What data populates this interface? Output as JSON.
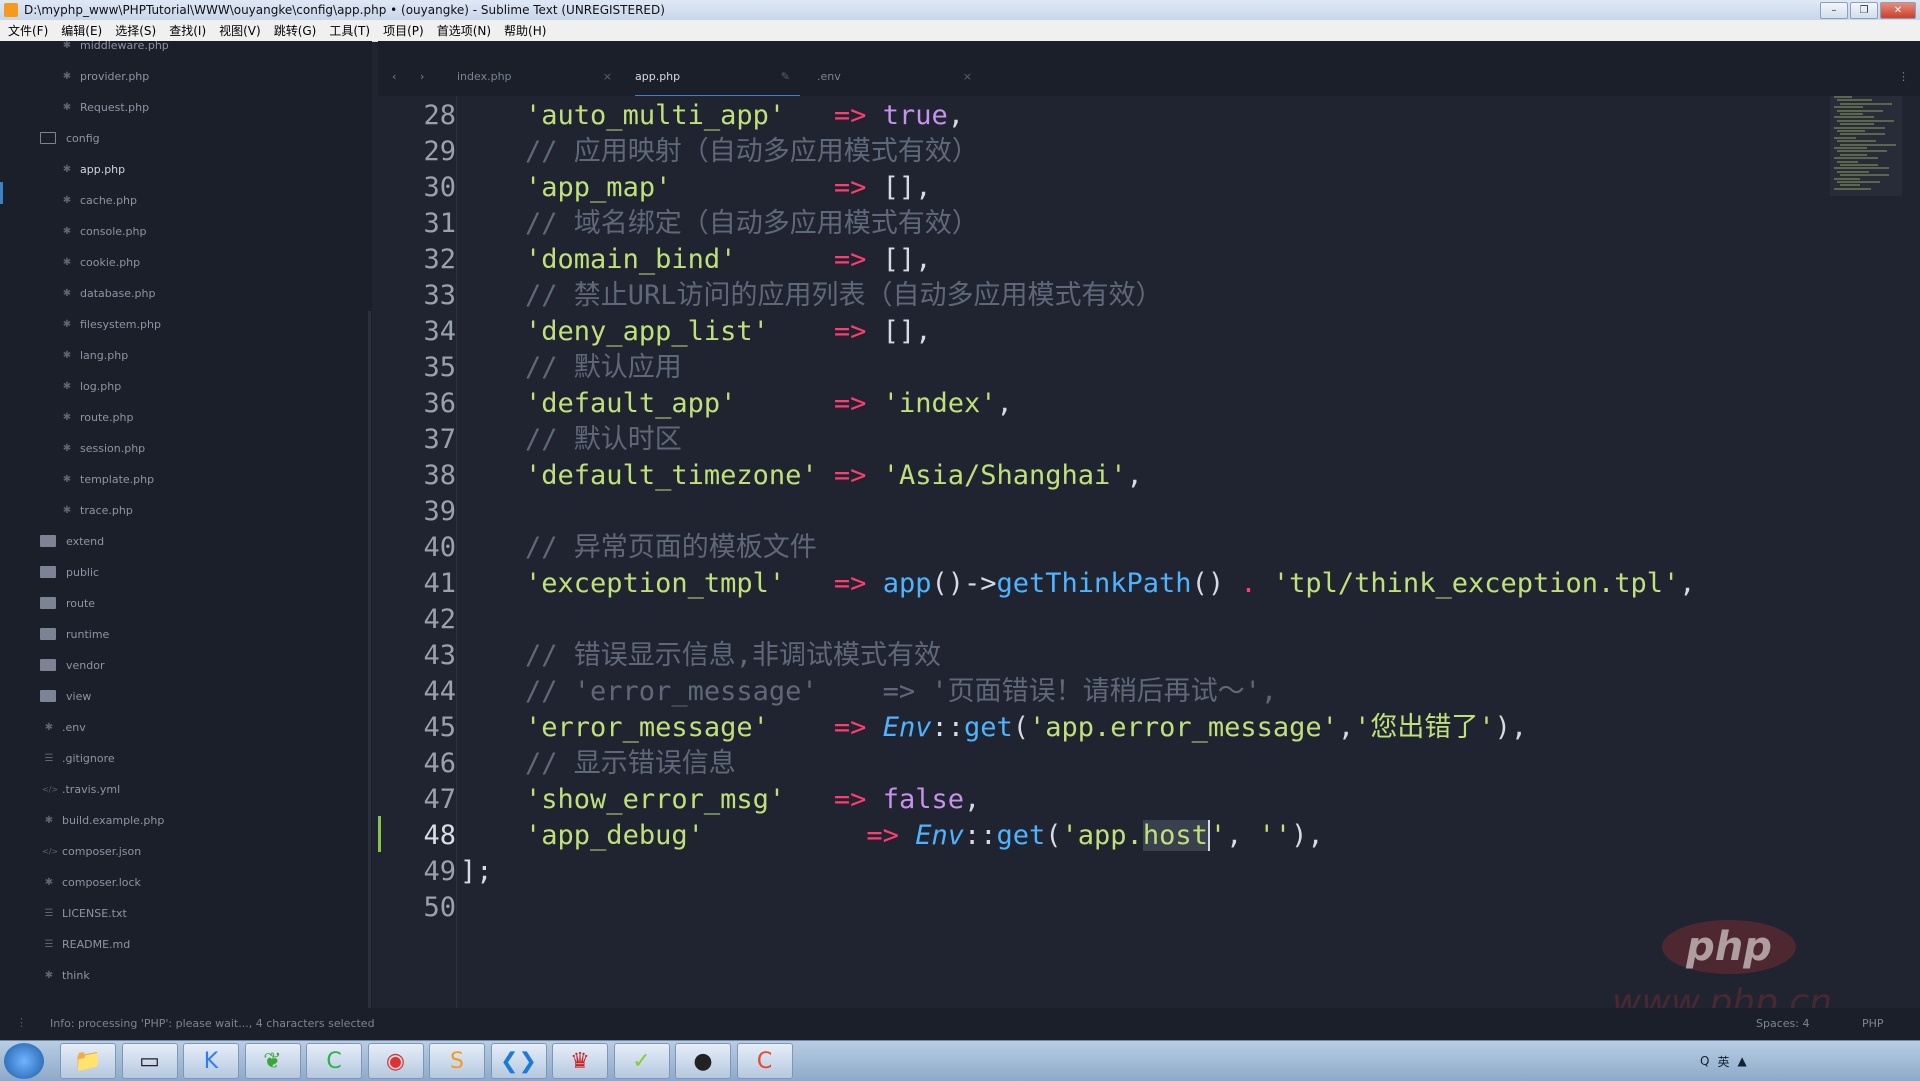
{
  "window": {
    "title": "D:\\myphp_www\\PHPTutorial\\WWW\\ouyangke\\config\\app.php • (ouyangke) - Sublime Text (UNREGISTERED)",
    "controls": [
      "–",
      "❐",
      "✕"
    ]
  },
  "menu": [
    "文件(F)",
    "编辑(E)",
    "选择(S)",
    "查找(I)",
    "视图(V)",
    "跳转(G)",
    "工具(T)",
    "项目(P)",
    "首选项(N)",
    "帮助(H)"
  ],
  "sidebar": {
    "items": [
      {
        "label": "middleware.php",
        "type": "file",
        "icon": "asterisk-icon"
      },
      {
        "label": "provider.php",
        "type": "file",
        "icon": "asterisk-icon"
      },
      {
        "label": "Request.php",
        "type": "file",
        "icon": "asterisk-icon"
      },
      {
        "label": "config",
        "type": "folder-open",
        "icon": "folder-open-icon"
      },
      {
        "label": "app.php",
        "type": "file",
        "icon": "asterisk-icon",
        "active": true
      },
      {
        "label": "cache.php",
        "type": "file",
        "icon": "asterisk-icon"
      },
      {
        "label": "console.php",
        "type": "file",
        "icon": "asterisk-icon"
      },
      {
        "label": "cookie.php",
        "type": "file",
        "icon": "asterisk-icon"
      },
      {
        "label": "database.php",
        "type": "file",
        "icon": "asterisk-icon"
      },
      {
        "label": "filesystem.php",
        "type": "file",
        "icon": "asterisk-icon"
      },
      {
        "label": "lang.php",
        "type": "file",
        "icon": "asterisk-icon"
      },
      {
        "label": "log.php",
        "type": "file",
        "icon": "asterisk-icon"
      },
      {
        "label": "route.php",
        "type": "file",
        "icon": "asterisk-icon"
      },
      {
        "label": "session.php",
        "type": "file",
        "icon": "asterisk-icon"
      },
      {
        "label": "template.php",
        "type": "file",
        "icon": "asterisk-icon"
      },
      {
        "label": "trace.php",
        "type": "file",
        "icon": "asterisk-icon"
      },
      {
        "label": "extend",
        "type": "folder",
        "icon": "folder-icon"
      },
      {
        "label": "public",
        "type": "folder",
        "icon": "folder-icon"
      },
      {
        "label": "route",
        "type": "folder",
        "icon": "folder-icon"
      },
      {
        "label": "runtime",
        "type": "folder",
        "icon": "folder-icon"
      },
      {
        "label": "vendor",
        "type": "folder",
        "icon": "folder-icon"
      },
      {
        "label": "view",
        "type": "folder",
        "icon": "folder-icon"
      },
      {
        "label": ".env",
        "type": "rootfile",
        "icon": "asterisk-icon"
      },
      {
        "label": ".gitignore",
        "type": "rootfile",
        "icon": "lines-icon"
      },
      {
        "label": ".travis.yml",
        "type": "rootfile",
        "icon": "code-icon"
      },
      {
        "label": "build.example.php",
        "type": "rootfile",
        "icon": "asterisk-icon"
      },
      {
        "label": "composer.json",
        "type": "rootfile",
        "icon": "code-icon"
      },
      {
        "label": "composer.lock",
        "type": "rootfile",
        "icon": "asterisk-icon"
      },
      {
        "label": "LICENSE.txt",
        "type": "rootfile",
        "icon": "lines-icon"
      },
      {
        "label": "README.md",
        "type": "rootfile",
        "icon": "lines-icon"
      },
      {
        "label": "think",
        "type": "rootfile",
        "icon": "asterisk-icon"
      }
    ]
  },
  "tabs": [
    {
      "label": "index.php",
      "close": "×"
    },
    {
      "label": "app.php",
      "close": "✎",
      "active": true
    },
    {
      "label": ".env",
      "close": "×"
    }
  ],
  "editor": {
    "current_line": 48,
    "lines": [
      {
        "n": 28,
        "tokens": [
          [
            "    ",
            "p"
          ],
          [
            "'auto_multi_app'",
            "s"
          ],
          [
            "   ",
            "p"
          ],
          [
            "=>",
            "o"
          ],
          [
            " ",
            "p"
          ],
          [
            "true",
            "k"
          ],
          [
            ",",
            "p"
          ]
        ]
      },
      {
        "n": 29,
        "tokens": [
          [
            "    // 应用映射（自动多应用模式有效）",
            "c"
          ]
        ]
      },
      {
        "n": 30,
        "tokens": [
          [
            "    ",
            "p"
          ],
          [
            "'app_map'",
            "s"
          ],
          [
            "          ",
            "p"
          ],
          [
            "=>",
            "o"
          ],
          [
            " [],",
            "p"
          ]
        ]
      },
      {
        "n": 31,
        "tokens": [
          [
            "    // 域名绑定（自动多应用模式有效）",
            "c"
          ]
        ]
      },
      {
        "n": 32,
        "tokens": [
          [
            "    ",
            "p"
          ],
          [
            "'domain_bind'",
            "s"
          ],
          [
            "      ",
            "p"
          ],
          [
            "=>",
            "o"
          ],
          [
            " [],",
            "p"
          ]
        ]
      },
      {
        "n": 33,
        "tokens": [
          [
            "    // 禁止URL访问的应用列表（自动多应用模式有效）",
            "c"
          ]
        ]
      },
      {
        "n": 34,
        "tokens": [
          [
            "    ",
            "p"
          ],
          [
            "'deny_app_list'",
            "s"
          ],
          [
            "    ",
            "p"
          ],
          [
            "=>",
            "o"
          ],
          [
            " [],",
            "p"
          ]
        ]
      },
      {
        "n": 35,
        "tokens": [
          [
            "    // 默认应用",
            "c"
          ]
        ]
      },
      {
        "n": 36,
        "tokens": [
          [
            "    ",
            "p"
          ],
          [
            "'default_app'",
            "s"
          ],
          [
            "      ",
            "p"
          ],
          [
            "=>",
            "o"
          ],
          [
            " ",
            "p"
          ],
          [
            "'index'",
            "s"
          ],
          [
            ",",
            "p"
          ]
        ]
      },
      {
        "n": 37,
        "tokens": [
          [
            "    // 默认时区",
            "c"
          ]
        ]
      },
      {
        "n": 38,
        "tokens": [
          [
            "    ",
            "p"
          ],
          [
            "'default_timezone'",
            "s"
          ],
          [
            " ",
            "p"
          ],
          [
            "=>",
            "o"
          ],
          [
            " ",
            "p"
          ],
          [
            "'Asia/Shanghai'",
            "s"
          ],
          [
            ",",
            "p"
          ]
        ]
      },
      {
        "n": 39,
        "tokens": []
      },
      {
        "n": 40,
        "tokens": [
          [
            "    // 异常页面的模板文件",
            "c"
          ]
        ]
      },
      {
        "n": 41,
        "tokens": [
          [
            "    ",
            "p"
          ],
          [
            "'exception_tmpl'",
            "s"
          ],
          [
            "   ",
            "p"
          ],
          [
            "=>",
            "o"
          ],
          [
            " ",
            "p"
          ],
          [
            "app",
            "f"
          ],
          [
            "()->",
            "p"
          ],
          [
            "getThinkPath",
            "f"
          ],
          [
            "() ",
            "p"
          ],
          [
            ".",
            "o"
          ],
          [
            " ",
            "p"
          ],
          [
            "'tpl/think_exception.tpl'",
            "s"
          ],
          [
            ",",
            "p"
          ]
        ]
      },
      {
        "n": 42,
        "tokens": []
      },
      {
        "n": 43,
        "tokens": [
          [
            "    // 错误显示信息,非调试模式有效",
            "c"
          ]
        ]
      },
      {
        "n": 44,
        "tokens": [
          [
            "    // 'error_message'    => '页面错误！请稍后再试～',",
            "c"
          ]
        ]
      },
      {
        "n": 45,
        "tokens": [
          [
            "    ",
            "p"
          ],
          [
            "'error_message'",
            "s"
          ],
          [
            "    ",
            "p"
          ],
          [
            "=>",
            "o"
          ],
          [
            " ",
            "p"
          ],
          [
            "Env",
            "e"
          ],
          [
            "::",
            "p"
          ],
          [
            "get",
            "f"
          ],
          [
            "(",
            "p"
          ],
          [
            "'app.error_message'",
            "s"
          ],
          [
            ",",
            "p"
          ],
          [
            "'您出错了'",
            "s"
          ],
          [
            "),",
            "p"
          ]
        ]
      },
      {
        "n": 46,
        "tokens": [
          [
            "    // 显示错误信息",
            "c"
          ]
        ]
      },
      {
        "n": 47,
        "tokens": [
          [
            "    ",
            "p"
          ],
          [
            "'show_error_msg'",
            "s"
          ],
          [
            "   ",
            "p"
          ],
          [
            "=>",
            "o"
          ],
          [
            " ",
            "p"
          ],
          [
            "false",
            "k"
          ],
          [
            ",",
            "p"
          ]
        ]
      },
      {
        "n": 48,
        "tokens": [
          [
            "    ",
            "p"
          ],
          [
            "'app_debug'",
            "s"
          ],
          [
            "          ",
            "p"
          ],
          [
            "=>",
            "o"
          ],
          [
            " ",
            "p"
          ],
          [
            "Env",
            "e"
          ],
          [
            "::",
            "p"
          ],
          [
            "get",
            "f"
          ],
          [
            "(",
            "p"
          ],
          [
            "'app.",
            "s"
          ],
          [
            "host",
            "s hl"
          ],
          [
            "'",
            "s caret"
          ],
          [
            ", ",
            "p"
          ],
          [
            "''",
            "s"
          ],
          [
            "),",
            "p"
          ]
        ]
      },
      {
        "n": 49,
        "tokens": [
          [
            "];",
            "p"
          ]
        ]
      },
      {
        "n": 50,
        "tokens": []
      }
    ]
  },
  "watermark": {
    "logo": "php",
    "url": "www.php.cn"
  },
  "status": {
    "message": "Info: processing 'PHP': please wait..., 4 characters selected",
    "spaces": "Spaces: 4",
    "syntax": "PHP"
  },
  "taskbar": {
    "apps": [
      "start-orb",
      "file-explorer",
      "terminal",
      "kuaichuan",
      "leaf-app",
      "pycharm-like",
      "chrome",
      "sublime-text",
      "vscode",
      "crown-app",
      "green-app",
      "obs",
      "red-app"
    ],
    "tray": [
      "Q",
      "英",
      "▲"
    ]
  }
}
